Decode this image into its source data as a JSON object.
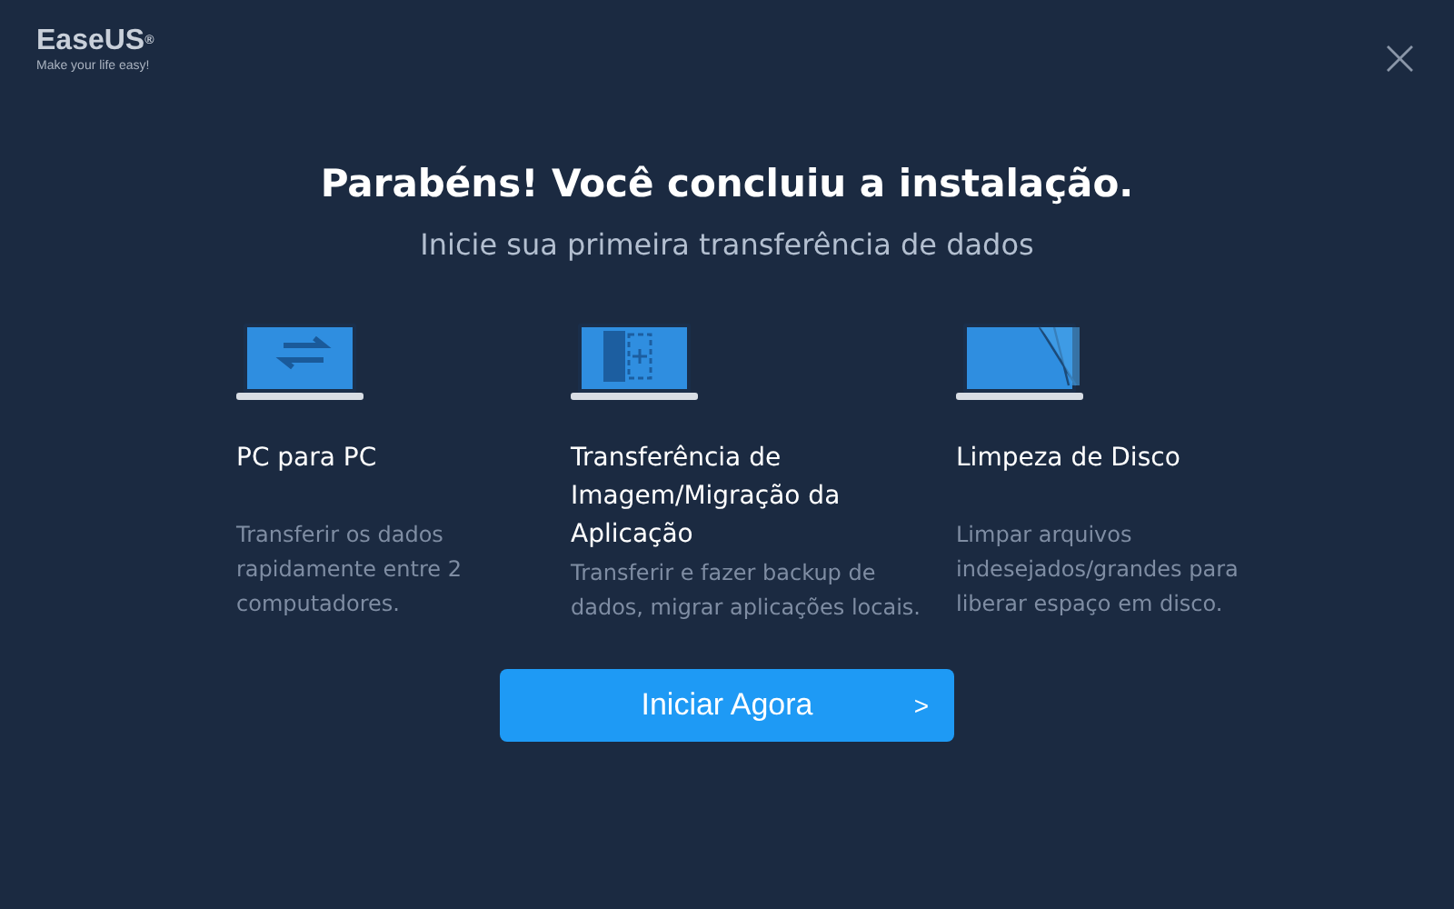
{
  "logo": {
    "name": "EaseUS",
    "mark": "®",
    "tagline": "Make your life easy!"
  },
  "close": "×",
  "heading": "Parabéns! Você concluiu a instalação.",
  "subheading": "Inicie sua primeira transferência de dados",
  "features": [
    {
      "kind": "transfer",
      "title": "PC para PC",
      "description": "Transferir os dados rapidamente entre 2 computadores."
    },
    {
      "kind": "migrate",
      "title": "Transferência de Imagem/Migração da Aplicação",
      "description": "Transferir e fazer backup de dados, migrar aplicações locais."
    },
    {
      "kind": "clean",
      "title": "Limpeza de Disco",
      "description": "Limpar arquivos indesejados/grandes para liberar espaço em disco."
    }
  ],
  "button": {
    "label": "Iniciar Agora",
    "arrow": ">"
  }
}
